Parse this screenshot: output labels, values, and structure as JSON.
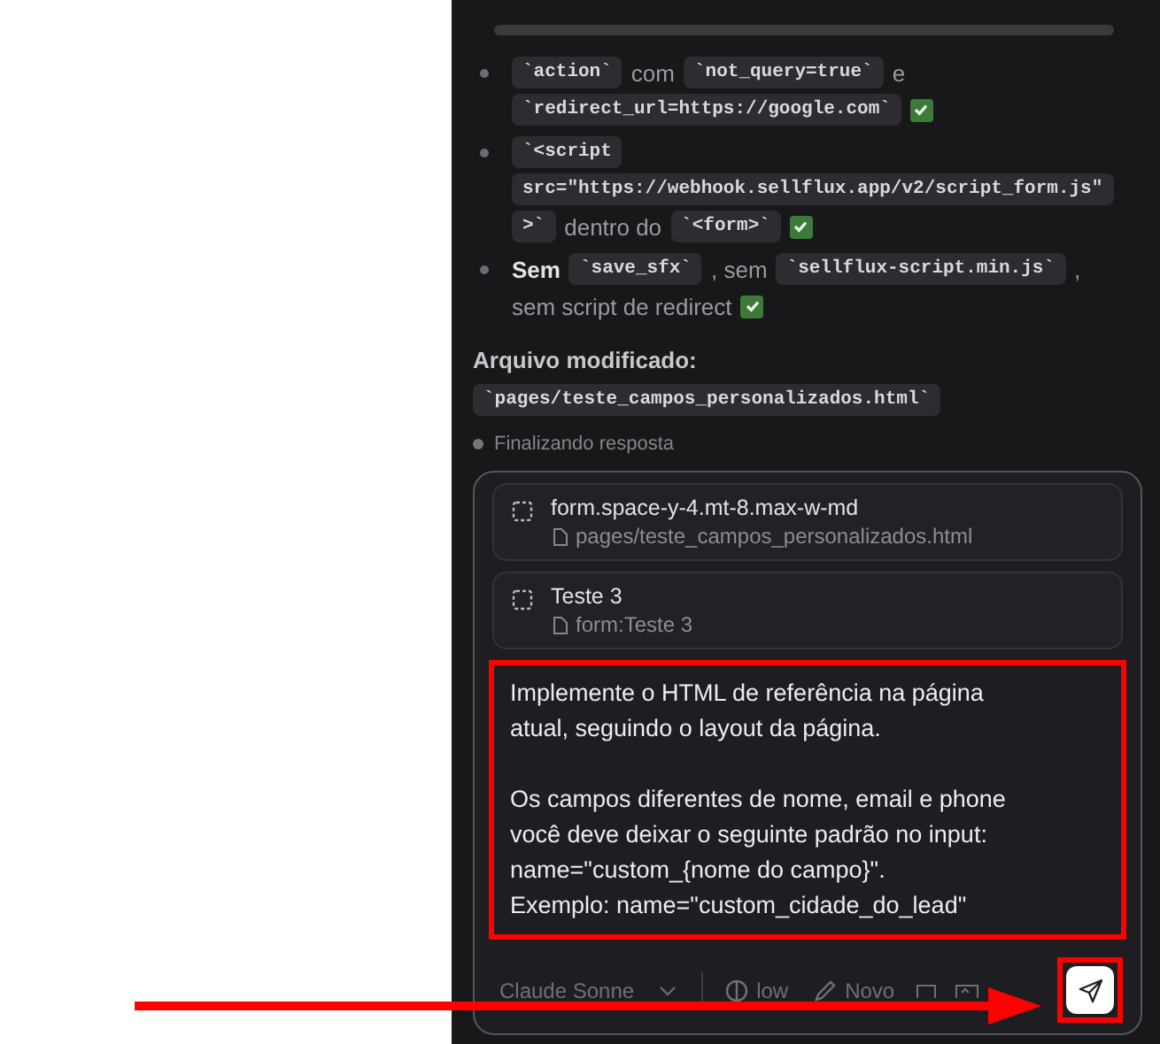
{
  "chat": {
    "bullets": [
      {
        "lines": [
          [
            {
              "kind": "code",
              "text": "`action`"
            },
            {
              "kind": "text",
              "text": "com"
            },
            {
              "kind": "code",
              "text": "`not_query=true`"
            },
            {
              "kind": "text",
              "text": "e"
            }
          ],
          [
            {
              "kind": "code",
              "text": "`redirect_url=https://google.com`"
            },
            {
              "kind": "check"
            }
          ]
        ]
      },
      {
        "lines": [
          [
            {
              "kind": "code",
              "text": "`<script"
            }
          ],
          [
            {
              "kind": "code",
              "text": "src=\"https://webhook.sellflux.app/v2/script_form.js\""
            }
          ],
          [
            {
              "kind": "code",
              "text": ">`"
            },
            {
              "kind": "text",
              "text": "dentro do"
            },
            {
              "kind": "code",
              "text": "`<form>`"
            },
            {
              "kind": "check"
            }
          ]
        ]
      },
      {
        "lines": [
          [
            {
              "kind": "bold",
              "text": "Sem"
            },
            {
              "kind": "code",
              "text": "`save_sfx`"
            },
            {
              "kind": "text",
              "text": ", sem"
            },
            {
              "kind": "code",
              "text": "`sellflux-script.min.js`"
            },
            {
              "kind": "text",
              "text": ","
            }
          ],
          [
            {
              "kind": "text",
              "text": "sem script de redirect"
            },
            {
              "kind": "check"
            }
          ]
        ]
      }
    ],
    "heading": "Arquivo modificado:",
    "file": "`pages/teste_campos_personalizados.html`",
    "status": "Finalizando resposta"
  },
  "composer": {
    "context": [
      {
        "title": "form.space-y-4.mt-8.max-w-md",
        "source": "pages/teste_campos_personalizados.html"
      },
      {
        "title": "Teste 3",
        "source": "form:Teste 3"
      }
    ],
    "message": [
      [
        "Implemente o HTML de referência na página",
        "atual, seguindo o layout da página."
      ],
      [
        "Os campos diferentes de nome, email e phone",
        "você deve deixar o seguinte padrão no input:",
        "name=\"custom_{nome do campo}\".",
        "Exemplo: name=\"custom_cidade_do_lead\""
      ]
    ],
    "model": "Claude Sonne",
    "effort": "low",
    "new_label": "Novo"
  }
}
